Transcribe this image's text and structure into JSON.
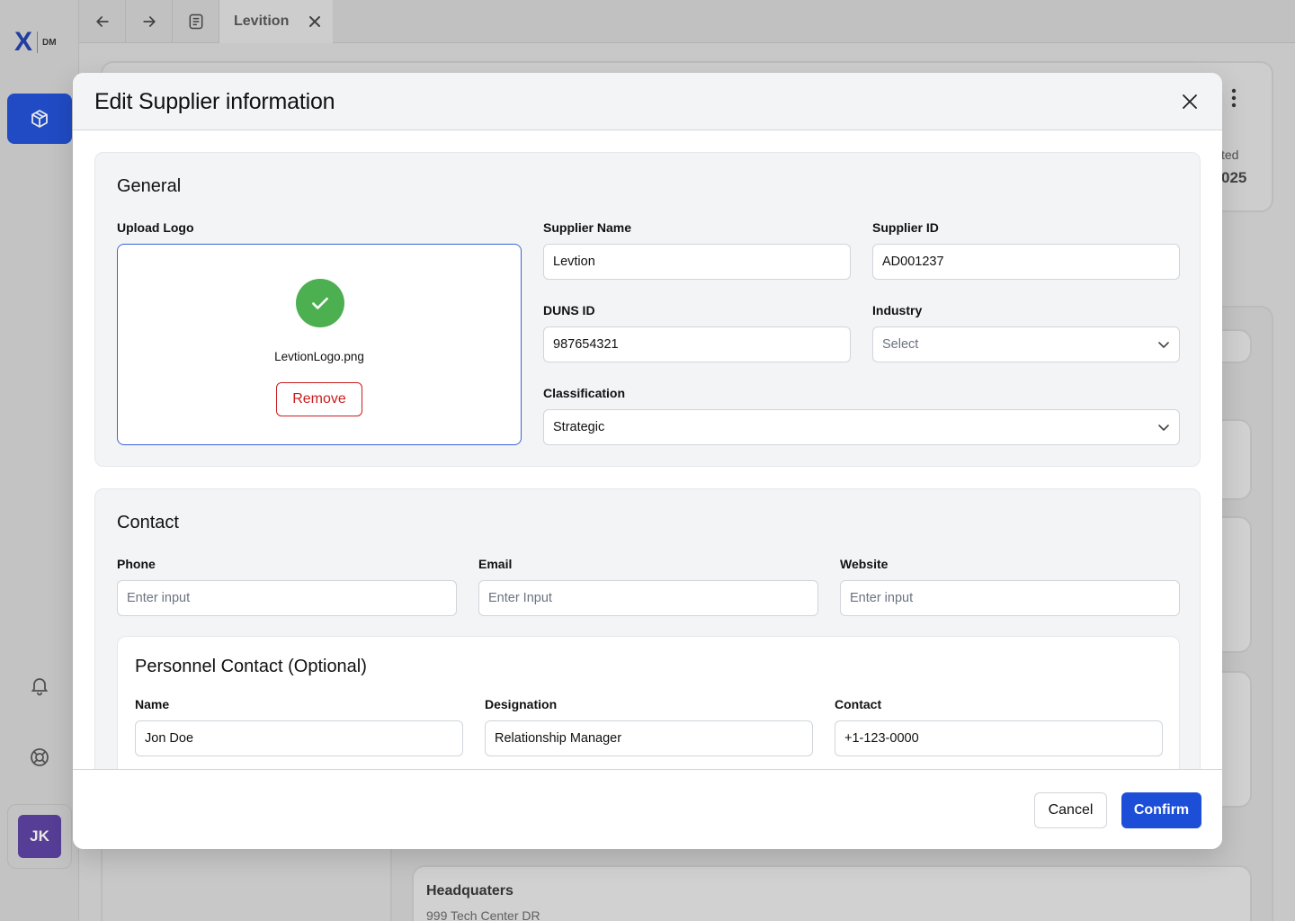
{
  "app": {
    "logo_mark": "X",
    "logo_text": "DM",
    "avatar_initials": "JK"
  },
  "topbar": {
    "tab_label": "Levition"
  },
  "background": {
    "partial_label": "ted",
    "partial_value": "025",
    "headquarters_label": "Headquaters",
    "headquarters_address": "999 Tech Center DR"
  },
  "modal": {
    "title": "Edit Supplier information",
    "general": {
      "title": "General",
      "upload_label": "Upload Logo",
      "file_name": "LevtionLogo.png",
      "remove_label": "Remove",
      "supplier_name_label": "Supplier Name",
      "supplier_name_value": "Levtion",
      "supplier_id_label": "Supplier ID",
      "supplier_id_value": "AD001237",
      "duns_label": "DUNS ID",
      "duns_value": "987654321",
      "industry_label": "Industry",
      "industry_value": "Select",
      "classification_label": "Classification",
      "classification_value": "Strategic"
    },
    "contact": {
      "title": "Contact",
      "phone_label": "Phone",
      "phone_placeholder": "Enter input",
      "email_label": "Email",
      "email_placeholder": "Enter Input",
      "website_label": "Website",
      "website_placeholder": "Enter input",
      "personnel": {
        "title": "Personnel Contact (Optional)",
        "name_label": "Name",
        "name_value": "Jon Doe",
        "designation_label": "Designation",
        "designation_value": "Relationship Manager",
        "contact_label": "Contact",
        "contact_value": "+1-123-0000"
      }
    },
    "footer": {
      "cancel_label": "Cancel",
      "confirm_label": "Confirm"
    }
  },
  "colors": {
    "primary": "#1d4ed8",
    "danger": "#c81e1e",
    "success": "#4caf50",
    "avatar": "#5b3ea3"
  }
}
